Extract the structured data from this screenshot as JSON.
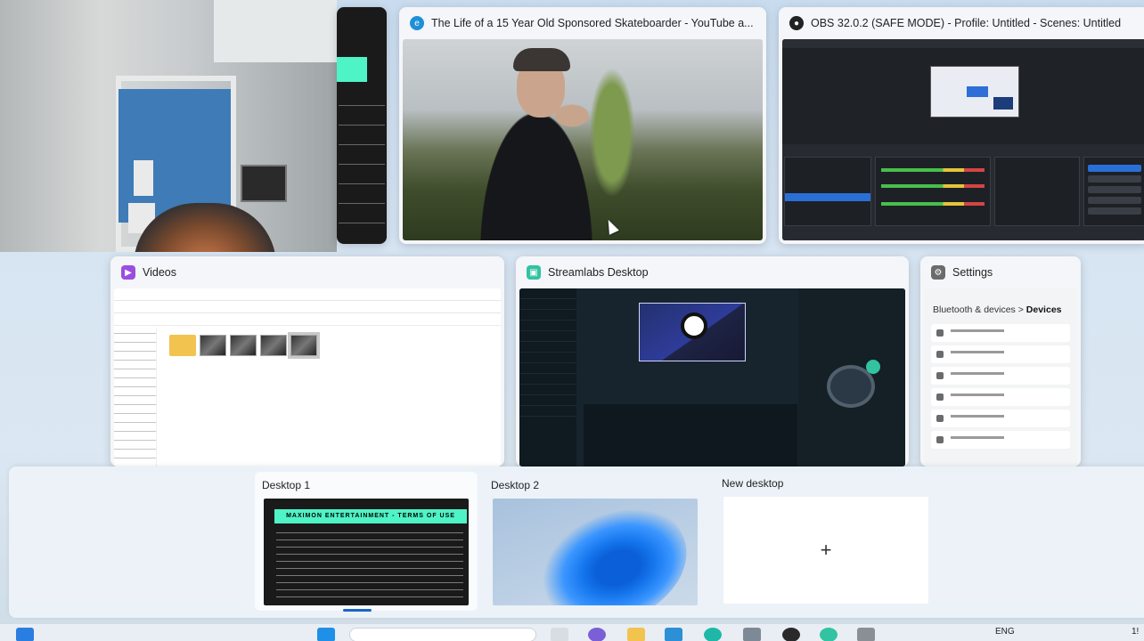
{
  "windows": [
    {
      "id": "youtube",
      "title": "The Life of a 15 Year Old Sponsored Skateboarder - YouTube a...",
      "icon": "edge-icon",
      "icon_color": "#1f8fd8"
    },
    {
      "id": "obs",
      "title": "OBS 32.0.2 (SAFE MODE) - Profile: Untitled - Scenes: Untitled",
      "icon": "obs-icon",
      "icon_color": "#222222"
    },
    {
      "id": "videos",
      "title": "Videos",
      "icon": "file-explorer-icon",
      "icon_color": "#9b4de0"
    },
    {
      "id": "streamlabs",
      "title": "Streamlabs Desktop",
      "icon": "streamlabs-icon",
      "icon_color": "#31c3a2"
    },
    {
      "id": "settings",
      "title": "Settings",
      "icon": "settings-gear-icon",
      "icon_color": "#6b6b6b",
      "breadcrumb_parent": "Bluetooth & devices",
      "breadcrumb_sep": ">",
      "breadcrumb_current": "Devices"
    }
  ],
  "desktop1_thumb_heading": "MAXIMON ENTERTAINMENT - TERMS OF USE",
  "desktops": [
    {
      "label": "Desktop 1",
      "active": true
    },
    {
      "label": "Desktop 2",
      "active": false
    },
    {
      "label": "New desktop",
      "active": false
    }
  ],
  "new_desktop_glyph": "+",
  "taskbar": {
    "language": "ENG",
    "clock_partial": "1!"
  },
  "colors": {
    "accent": "#1b66c9",
    "terms_header": "#4ef3c6"
  }
}
